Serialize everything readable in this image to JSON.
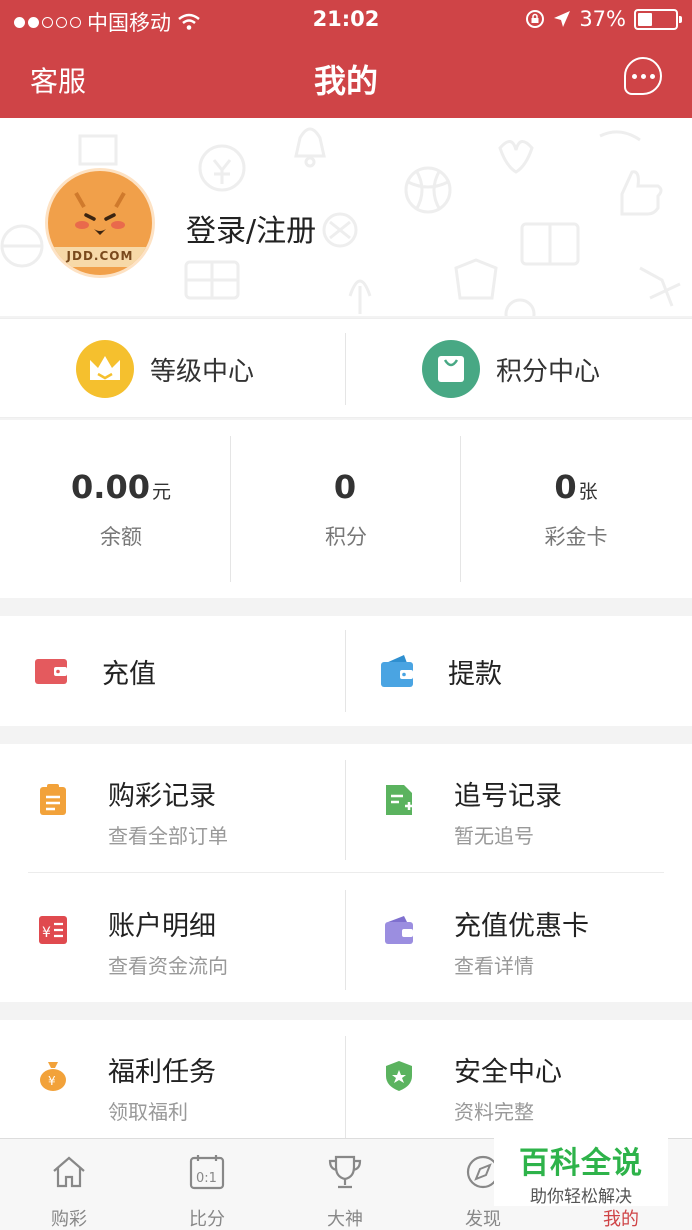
{
  "status_bar": {
    "carrier": "中国移动",
    "time": "21:02",
    "battery": "37%"
  },
  "nav": {
    "left": "客服",
    "title": "我的",
    "chat_icon": "chat-bubble-icon"
  },
  "profile": {
    "avatar_text": "JDD.COM",
    "login_text": "登录/注册"
  },
  "quick_links": [
    {
      "label": "等级中心",
      "icon": "crown-icon",
      "color": "#f5c02e"
    },
    {
      "label": "积分中心",
      "icon": "shopping-bag-icon",
      "color": "#48a884"
    }
  ],
  "stats": [
    {
      "value": "0.00",
      "unit": "元",
      "label": "余额"
    },
    {
      "value": "0",
      "unit": "",
      "label": "积分"
    },
    {
      "value": "0",
      "unit": "张",
      "label": "彩金卡"
    }
  ],
  "wallet": {
    "recharge": "充值",
    "withdraw": "提款"
  },
  "menu": [
    {
      "title": "购彩记录",
      "sub": "查看全部订单",
      "icon": "clipboard-icon",
      "color": "#f2a23a"
    },
    {
      "title": "追号记录",
      "sub": "暂无追号",
      "icon": "document-add-icon",
      "color": "#5bb35f"
    },
    {
      "title": "账户明细",
      "sub": "查看资金流向",
      "icon": "ledger-icon",
      "color": "#e04a4f"
    },
    {
      "title": "充值优惠卡",
      "sub": "查看详情",
      "icon": "card-wallet-icon",
      "color": "#9b8ee0"
    },
    {
      "title": "福利任务",
      "sub": "领取福利",
      "icon": "money-bag-icon",
      "color": "#f2a23a"
    },
    {
      "title": "安全中心",
      "sub": "资料完整",
      "icon": "shield-icon",
      "color": "#5bb35f"
    }
  ],
  "tabs": [
    {
      "label": "购彩",
      "icon": "home-icon"
    },
    {
      "label": "比分",
      "icon": "scoreboard-icon"
    },
    {
      "label": "大神",
      "icon": "trophy-icon"
    },
    {
      "label": "发现",
      "icon": "compass-icon"
    },
    {
      "label": "我的",
      "icon": "user-icon",
      "active": true
    }
  ],
  "watermark": {
    "title": "百科全说",
    "subtitle": "助你轻松解决"
  },
  "colors": {
    "brand": "#cf4447",
    "active_tab": "#cf4447"
  }
}
